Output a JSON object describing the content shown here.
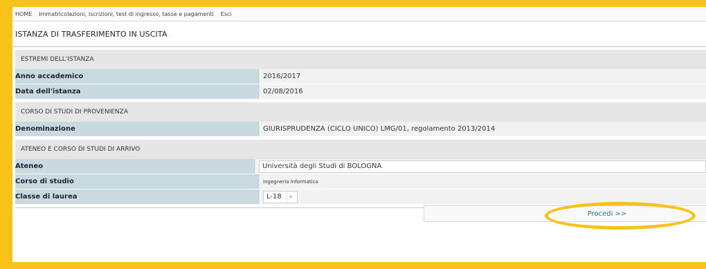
{
  "nav": {
    "home": "HOME",
    "immatricolazioni": "Immatricolazioni, iscrizioni, test di ingresso, tasse e pagamenti",
    "esci": "Esci"
  },
  "page": {
    "title": "ISTANZA DI TRASFERIMENTO IN USCITA"
  },
  "sections": {
    "estremi": {
      "header": "ESTREMI DELL'ISTANZA",
      "anno_label": "Anno accademico",
      "anno_value": "2016/2017",
      "data_label": "Data dell'istanza",
      "data_value": "02/08/2016"
    },
    "provenienza": {
      "header": "CORSO DI STUDI DI PROVENIENZA",
      "denominazione_label": "Denominazione",
      "denominazione_value": "GIURISPRUDENZA (CICLO UNICO) LMG/01, regolamento 2013/2014"
    },
    "arrivo": {
      "header": "ATENEO E CORSO DI STUDI DI ARRIVO",
      "ateneo_label": "Ateneo",
      "ateneo_value": "Università degli Studi di BOLOGNA",
      "corso_label": "Corso di studio",
      "corso_value": "Ingegneria Informatica",
      "classe_label": "Classe di laurea",
      "classe_value": "L-18"
    }
  },
  "actions": {
    "procedi": "Procedi >>"
  },
  "colors": {
    "highlight": "#f7c21a",
    "label_bg": "#c8dae0",
    "value_bg": "#f2f2f2",
    "section_bg": "#e6e6e6",
    "link": "#2a6f97"
  }
}
